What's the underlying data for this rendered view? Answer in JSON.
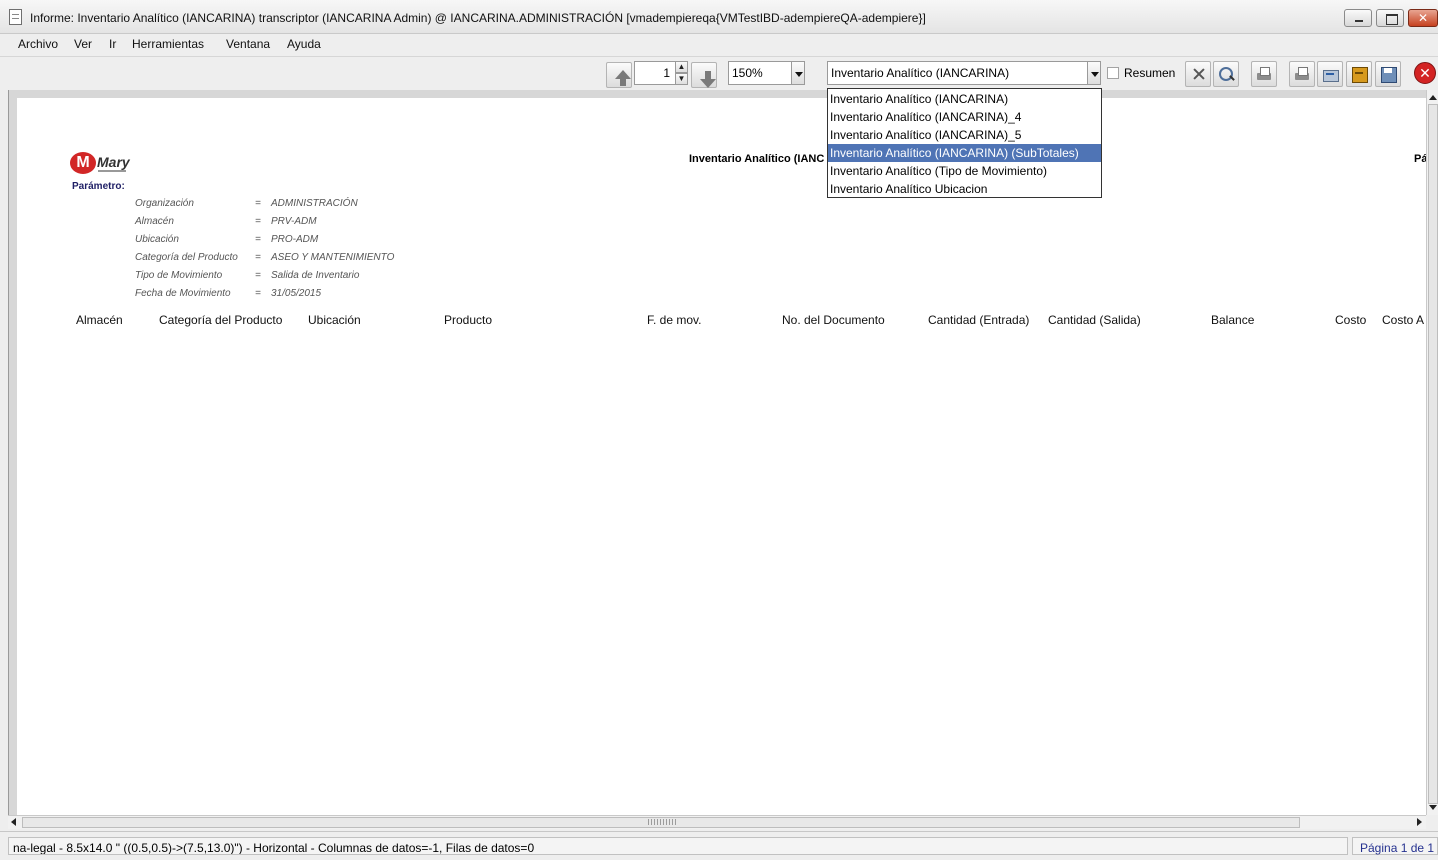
{
  "window": {
    "title": "Informe: Inventario Analítico (IANCARINA)  transcriptor (IANCARINA Admin) @ IANCARINA.ADMINISTRACIÓN [vmadempiereqa{VMTestIBD-adempiereQA-adempiere}]",
    "minimize_glyph": "",
    "maximize_glyph": "",
    "close_glyph": "✕"
  },
  "menu": {
    "items": [
      "Archivo",
      "Ver",
      "Ir",
      "Herramientas",
      "Ventana",
      "Ayuda"
    ]
  },
  "toolbar": {
    "page_number": "1",
    "spin_up": "▲",
    "spin_down": "▼",
    "zoom": "150%",
    "report_selected": "Inventario Analítico (IANCARINA)",
    "summary_label": "Resumen",
    "summary_checked": false,
    "close_glyph": "✕",
    "icons": [
      "previous-page-icon",
      "next-page-icon",
      "customize-icon",
      "find-icon",
      "print-preview-icon",
      "print-icon",
      "export-icon",
      "archive-icon",
      "save-icon",
      "close-icon"
    ]
  },
  "report_dropdown": {
    "options": [
      "Inventario Analítico (IANCARINA)",
      "Inventario Analítico (IANCARINA)_4",
      "Inventario Analítico (IANCARINA)_5",
      "Inventario Analítico (IANCARINA) (SubTotales)",
      "Inventario Analítico (Tipo de Movimiento)",
      "Inventario Analítico Ubicacion"
    ],
    "highlighted_index": 3
  },
  "report": {
    "logo_letter": "M",
    "logo_word": "Mary",
    "title": "Inventario Analítico (IANC",
    "page_prefix": "Pá",
    "parameters_header": "Parámetro:",
    "parameters": [
      {
        "name": "Organización",
        "op": "=",
        "value": "ADMINISTRACIÓN"
      },
      {
        "name": "Almacén",
        "op": "=",
        "value": "PRV-ADM"
      },
      {
        "name": "Ubicación",
        "op": "=",
        "value": "PRO-ADM"
      },
      {
        "name": "Categoría del Producto",
        "op": "=",
        "value": "ASEO Y MANTENIMIENTO"
      },
      {
        "name": "Tipo de Movimiento",
        "op": "=",
        "value": "Salida de Inventario"
      },
      {
        "name": "Fecha de Movimiento",
        "op": "=",
        "value": "31/05/2015"
      }
    ],
    "columns": [
      "Almacén",
      "Categoría del Producto",
      "Ubicación",
      "Producto",
      "F. de mov.",
      "No. del Documento",
      "Cantidad (Entrada)",
      "Cantidad (Salida)",
      "Balance",
      "Costo",
      "Costo A"
    ]
  },
  "status": {
    "text": "na-legal - 8.5x14.0 \" ((0.5,0.5)->(7.5,13.0)\") - Horizontal - Columnas de datos=-1, Filas de datos=0",
    "page_info": "Página 1 de 1"
  }
}
